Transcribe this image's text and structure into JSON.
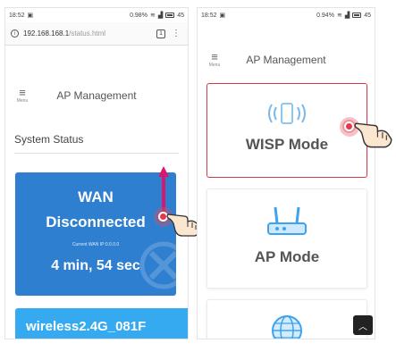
{
  "left_phone": {
    "status_bar": {
      "time": "18:52",
      "right": "0.98%",
      "battery": "45"
    },
    "browser": {
      "url_host": "192.168.168.1",
      "url_path": "/status.html",
      "tab_count": "1"
    },
    "header": {
      "menu_icon": "hamburger-icon",
      "menu_label": "Menu",
      "title": "AP Management"
    },
    "section_title": "System Status",
    "wan_card": {
      "title": "WAN",
      "state": "Disconnected",
      "ip_label": "Current WAN IP:0.0.0.0",
      "uptime": "4 min, 54 sec",
      "color": "#2f7fd0"
    },
    "wireless_card": {
      "label": "wireless2.4G_081F",
      "color": "#35aaf0"
    }
  },
  "right_phone": {
    "status_bar": {
      "time": "18:52",
      "right": "0.94%",
      "battery": "45"
    },
    "header": {
      "menu_icon": "hamburger-icon",
      "menu_label": "Menu",
      "title": "AP Management"
    },
    "modes": [
      {
        "label": "WISP Mode",
        "icon": "wireless-repeater-icon",
        "selected": true
      },
      {
        "label": "AP Mode",
        "icon": "router-icon",
        "selected": false
      },
      {
        "label": "",
        "icon": "globe-icon",
        "selected": false
      }
    ],
    "scroll_top_icon": "chevron-up-icon"
  },
  "accent": {
    "tap_red": "#e2394f",
    "arrow_magenta": "#d8186f",
    "selected_border": "#d83a45"
  }
}
